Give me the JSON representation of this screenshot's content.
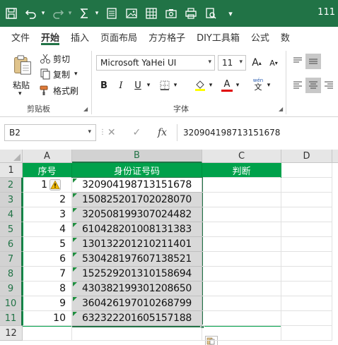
{
  "titlebar": {
    "title": "111",
    "accent": "#217346"
  },
  "tabs": [
    "文件",
    "开始",
    "插入",
    "页面布局",
    "方方格子",
    "DIY工具箱",
    "公式",
    "数"
  ],
  "ribbon": {
    "clipboard": {
      "paste": "粘贴",
      "cut": "剪切",
      "copy": "复制",
      "format_painter": "格式刷",
      "group": "剪贴板"
    },
    "font": {
      "name": "Microsoft YaHei UI",
      "size": "11",
      "bold": "B",
      "italic": "I",
      "underline": "U",
      "grow": "A",
      "shrink": "A",
      "phonetic_top": "wén",
      "phonetic_bottom": "文",
      "group": "字体"
    }
  },
  "formula_bar": {
    "name_box": "B2",
    "fx": "fx",
    "value": "320904198713151678"
  },
  "grid": {
    "columns": [
      "A",
      "B",
      "C",
      "D"
    ],
    "rows": [
      "1",
      "2",
      "3",
      "4",
      "5",
      "6",
      "7",
      "8",
      "9",
      "10",
      "11",
      "12"
    ],
    "headers": [
      "序号",
      "身份证号码",
      "判断"
    ],
    "header_color": "#00a14b",
    "records": [
      {
        "no": "1",
        "id": "320904198713151678"
      },
      {
        "no": "2",
        "id": "150825201702028070"
      },
      {
        "no": "3",
        "id": "320508199307024482"
      },
      {
        "no": "4",
        "id": "610428201008131383"
      },
      {
        "no": "5",
        "id": "130132201210211401"
      },
      {
        "no": "6",
        "id": "530428197607138521"
      },
      {
        "no": "7",
        "id": "152529201310158694"
      },
      {
        "no": "8",
        "id": "430382199301208650"
      },
      {
        "no": "9",
        "id": "360426197010268799"
      },
      {
        "no": "10",
        "id": "632322201605157188"
      }
    ]
  }
}
